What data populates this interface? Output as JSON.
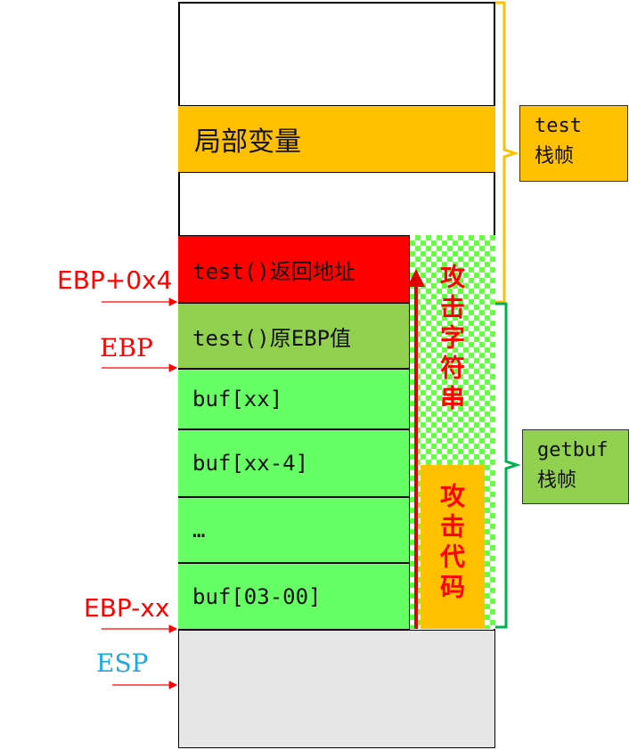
{
  "stack": {
    "local_vars": "局部变量",
    "return_addr": "test()返回地址",
    "saved_ebp": "test()原EBP值",
    "buf_cells": [
      "buf[xx]",
      "buf[xx-4]",
      "…",
      "buf[03-00]"
    ]
  },
  "attack": {
    "attack_string": "攻击字符串",
    "attack_code": "攻击代码"
  },
  "registers": {
    "ebp_plus": "EBP+0x4",
    "ebp": "EBP",
    "ebp_minus": "EBP-xx",
    "esp": "ESP"
  },
  "frames": {
    "test_line1": "test",
    "test_line2": "栈帧",
    "getbuf_line1": "getbuf",
    "getbuf_line2": "栈帧"
  },
  "colors": {
    "red": "#ff0000",
    "orange": "#ffc000",
    "light_green": "#92d050",
    "bright_green": "#66ff66",
    "brace_orange": "#ffc000",
    "brace_green": "#00b050",
    "esp_blue": "#1fa7e0",
    "esp_gray": "#e6e6e6"
  }
}
